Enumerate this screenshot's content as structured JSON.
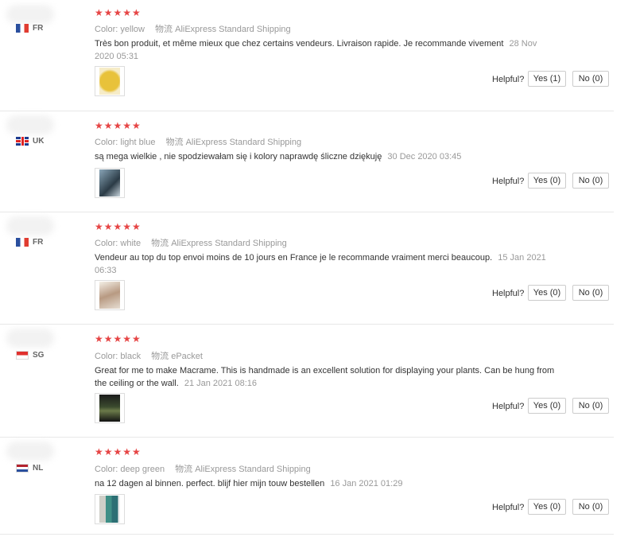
{
  "reviews": [
    {
      "country": "FR",
      "stars": "★★★★★",
      "color_label": "Color:",
      "color": "yellow",
      "shipping_label": "物流",
      "shipping": "AliExpress Standard Shipping",
      "text": "Très bon produit, et même mieux que chez certains vendeurs. Livraison rapide. Je recommande vivement",
      "date": "28 Nov 2020 05:31",
      "helpful_label": "Helpful?",
      "yes_label": "Yes (1)",
      "no_label": "No (0)"
    },
    {
      "country": "UK",
      "stars": "★★★★★",
      "color_label": "Color:",
      "color": "light blue",
      "shipping_label": "物流",
      "shipping": "AliExpress Standard Shipping",
      "text": "są mega wielkie , nie spodziewałam się i kolory naprawdę śliczne dziękuję",
      "date": "30 Dec 2020 03:45",
      "helpful_label": "Helpful?",
      "yes_label": "Yes (0)",
      "no_label": "No (0)"
    },
    {
      "country": "FR",
      "stars": "★★★★★",
      "color_label": "Color:",
      "color": "white",
      "shipping_label": "物流",
      "shipping": "AliExpress Standard Shipping",
      "text": "Vendeur au top du top envoi moins de 10 jours en France je le recommande vraiment merci beaucoup.",
      "date": "15 Jan 2021 06:33",
      "helpful_label": "Helpful?",
      "yes_label": "Yes (0)",
      "no_label": "No (0)"
    },
    {
      "country": "SG",
      "stars": "★★★★★",
      "color_label": "Color:",
      "color": "black",
      "shipping_label": "物流",
      "shipping": "ePacket",
      "text": "Great for me to make Macrame. This is handmade is an excellent solution for displaying your plants. Can be hung from the ceiling or the wall.",
      "date": "21 Jan 2021 08:16",
      "helpful_label": "Helpful?",
      "yes_label": "Yes (0)",
      "no_label": "No (0)"
    },
    {
      "country": "NL",
      "stars": "★★★★★",
      "color_label": "Color:",
      "color": "deep green",
      "shipping_label": "物流",
      "shipping": "AliExpress Standard Shipping",
      "text": "na 12 dagen al binnen. perfect. blijf hier mijn touw bestellen",
      "date": "16 Jan 2021 01:29",
      "helpful_label": "Helpful?",
      "yes_label": "Yes (0)",
      "no_label": "No (0)"
    }
  ],
  "colors": {
    "star": "#e64545",
    "border": "#e8e8e8",
    "muted": "#999999"
  }
}
